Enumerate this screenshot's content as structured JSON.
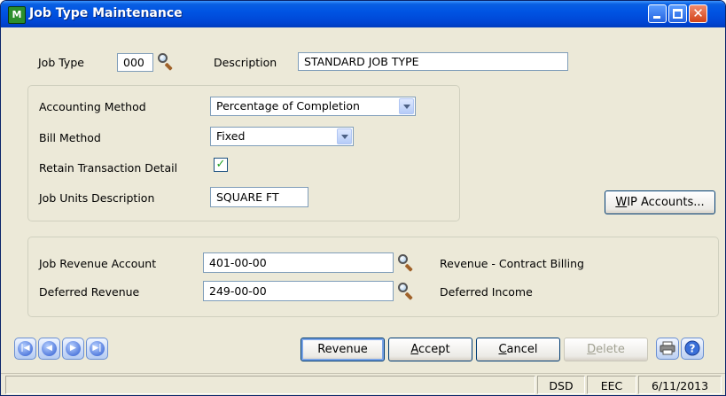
{
  "window": {
    "title": "Job Type Maintenance",
    "icon_text": "M"
  },
  "header": {
    "job_type_label": "Job Type",
    "job_type_value": "000",
    "description_label": "Description",
    "description_value": "STANDARD JOB TYPE"
  },
  "settings": {
    "accounting_method_label": "Accounting Method",
    "accounting_method_value": "Percentage of Completion",
    "bill_method_label": "Bill Method",
    "bill_method_value": "Fixed",
    "retain_detail_label": "Retain Transaction Detail",
    "retain_detail_checked": true,
    "job_units_label": "Job Units Description",
    "job_units_value": "SQUARE FT",
    "wip_button": {
      "prefix": "W",
      "rest": "IP Accounts..."
    }
  },
  "accounts": {
    "revenue_label": "Job Revenue Account",
    "revenue_value": "401-00-00",
    "revenue_desc": "Revenue - Contract Billing",
    "deferred_label": "Deferred Revenue",
    "deferred_value": "249-00-00",
    "deferred_desc": "Deferred Income"
  },
  "buttons": {
    "revenue": "Revenue",
    "accept": {
      "prefix": "A",
      "rest": "ccept"
    },
    "cancel": {
      "prefix": "C",
      "rest": "ancel"
    },
    "delete": {
      "prefix": "D",
      "rest": "elete"
    }
  },
  "status": {
    "company": "DSD",
    "user": "EEC",
    "date": "6/11/2013"
  },
  "icons": [
    "first-record-icon",
    "previous-record-icon",
    "next-record-icon",
    "last-record-icon",
    "printer-icon",
    "help-icon",
    "lookup-icon",
    "checkmark-icon",
    "dropdown-arrow-icon"
  ]
}
